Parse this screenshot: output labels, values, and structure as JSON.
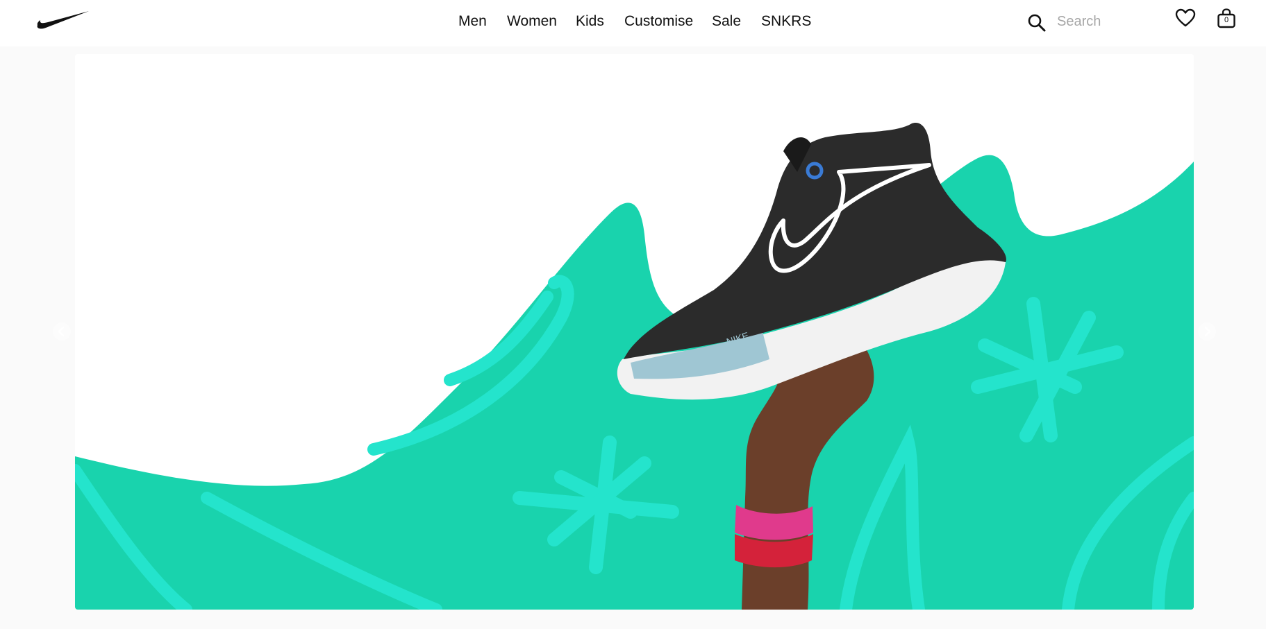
{
  "header": {
    "logo_icon": "nike-swoosh-icon",
    "nav": [
      {
        "label": "Men"
      },
      {
        "label": "Women"
      },
      {
        "label": "Kids"
      },
      {
        "label": "Customise"
      },
      {
        "label": "Sale"
      },
      {
        "label": "SNKRS"
      }
    ],
    "search": {
      "icon": "search-icon",
      "placeholder": "Search",
      "value": ""
    },
    "favourites_icon": "heart-icon",
    "bag": {
      "icon": "bag-icon",
      "count": "0"
    }
  },
  "hero": {
    "carousel_prev_icon": "chevron-left-icon",
    "carousel_next_icon": "chevron-right-icon",
    "shoe_text": "NIKE",
    "colors": {
      "background": "#ffffff",
      "wave": "#19d3ad",
      "wave_accent": "#24e4cc",
      "shoe_upper": "#2b2b2b",
      "sole": "#f2f2f2",
      "sole_accent": "#9fc6d3",
      "skin": "#6b3f2a",
      "band_pink": "#e03a8c",
      "band_red": "#d4223a"
    }
  }
}
